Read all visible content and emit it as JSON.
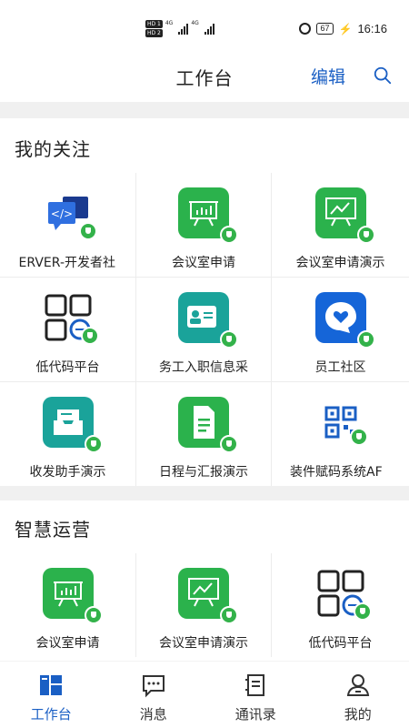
{
  "status_bar": {
    "sim1": "HD 1",
    "sim2": "HD 2",
    "net1": "4G",
    "net2": "4G",
    "battery": "67",
    "time": "16:16"
  },
  "header": {
    "title": "工作台",
    "edit_label": "编辑",
    "search_icon": "search-icon"
  },
  "sections": [
    {
      "title": "我的关注",
      "apps": [
        {
          "label": "ERVER-开发者社",
          "icon": "code-chat-icon"
        },
        {
          "label": "会议室申请",
          "icon": "presentation-chart-icon"
        },
        {
          "label": "会议室申请演示",
          "icon": "presentation-trend-icon"
        },
        {
          "label": "低代码平台",
          "icon": "lowcode-grid-icon"
        },
        {
          "label": "务工入职信息采",
          "icon": "id-card-icon"
        },
        {
          "label": "员工社区",
          "icon": "community-heart-icon"
        },
        {
          "label": "收发助手演示",
          "icon": "inbox-icon"
        },
        {
          "label": "日程与汇报演示",
          "icon": "document-icon"
        },
        {
          "label": "装件赋码系统AF",
          "icon": "qr-code-icon"
        }
      ]
    },
    {
      "title": "智慧运营",
      "apps": [
        {
          "label": "会议室申请",
          "icon": "presentation-chart-icon"
        },
        {
          "label": "会议室申请演示",
          "icon": "presentation-trend-icon"
        },
        {
          "label": "低代码平台",
          "icon": "lowcode-grid-icon"
        }
      ]
    }
  ],
  "bottom_nav": [
    {
      "label": "工作台",
      "icon": "workbench-icon",
      "active": true
    },
    {
      "label": "消息",
      "icon": "message-icon",
      "active": false
    },
    {
      "label": "通讯录",
      "icon": "contacts-icon",
      "active": false
    },
    {
      "label": "我的",
      "icon": "profile-icon",
      "active": false
    }
  ],
  "colors": {
    "accent": "#1a5fc4",
    "green_tile": "#2bb24c",
    "teal_tile": "#1aa39a",
    "blue_tile": "#1565d8",
    "badge": "#33b24a",
    "separator": "#f0f0f0"
  }
}
